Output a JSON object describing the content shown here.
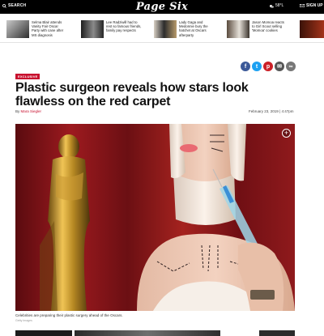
{
  "header": {
    "search_label": "SEARCH",
    "logo": "Page Six",
    "weather": "58°L",
    "signup_label": "SIGN UP"
  },
  "trending": [
    {
      "text": "Selma Blair attends Vanity Fair Oscar Party with cane after MS diagnosis"
    },
    {
      "text": "Lee Radziwill had to rest so famous friends, family pay respects"
    },
    {
      "text": "Lady Gaga and Medonnie bury the hatchet at Oscars afterparty"
    },
    {
      "text": "Jason Momoa reacts to Girl Scout selling 'Momoa' cookies"
    }
  ],
  "share": [
    {
      "icon": "facebook-icon",
      "glyph": "f",
      "color": "#3b5998"
    },
    {
      "icon": "twitter-icon",
      "glyph": "t",
      "color": "#1da1f2"
    },
    {
      "icon": "pinterest-icon",
      "glyph": "p",
      "color": "#cb2027"
    },
    {
      "icon": "email-icon",
      "glyph": "✉",
      "color": "#555555"
    },
    {
      "icon": "link-icon",
      "glyph": "∞",
      "color": "#777777"
    }
  ],
  "article": {
    "badge": "EXCLUSIVE",
    "headline": "Plastic surgeon reveals how stars look flawless on the red carpet",
    "byline_prefix": "By",
    "author": "Mara Siegler",
    "date": "February 23, 2019 | 4:47pm",
    "caption": "Celebrities are preparing their plastic surgery ahead of the Oscars.",
    "credit": "Getty Images"
  },
  "colors": {
    "accent": "#c8102e",
    "topbar": "#000000"
  }
}
